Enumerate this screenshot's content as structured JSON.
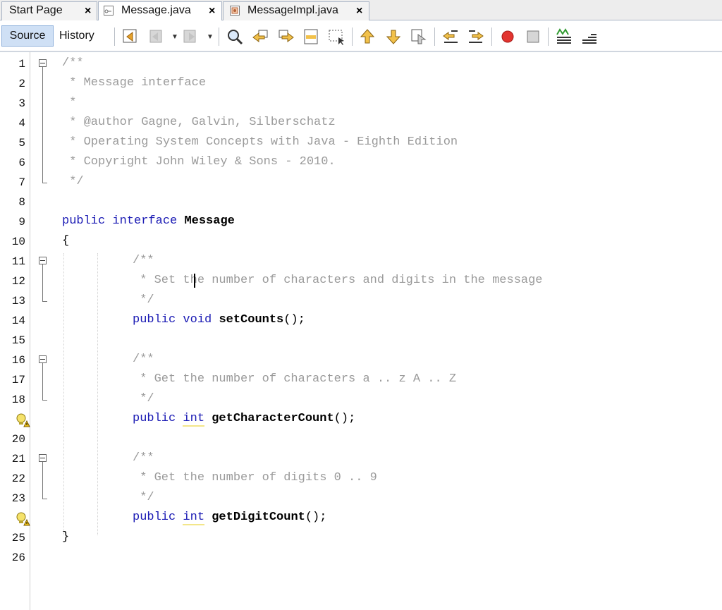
{
  "tabs": [
    {
      "label": "Start Page",
      "icon": "none",
      "active": false
    },
    {
      "label": "Message.java",
      "icon": "java-interface-icon",
      "active": true
    },
    {
      "label": "MessageImpl.java",
      "icon": "java-class-icon",
      "active": false
    }
  ],
  "toolbar": {
    "source_label": "Source",
    "history_label": "History",
    "icons": [
      "last-edit-icon",
      "back-icon",
      "forward-icon",
      "find-selection-icon",
      "find-previous-icon",
      "find-next-icon",
      "toggle-highlight-icon",
      "toggle-rectangular-selection-icon",
      "previous-bookmark-icon",
      "next-bookmark-icon",
      "toggle-bookmark-icon",
      "shift-left-icon",
      "shift-right-icon",
      "start-macro-icon",
      "stop-macro-icon",
      "comment-icon",
      "uncomment-icon"
    ]
  },
  "gutter": {
    "line_numbers": [
      "1",
      "2",
      "3",
      "4",
      "5",
      "6",
      "7",
      "8",
      "9",
      "10",
      "11",
      "12",
      "13",
      "14",
      "15",
      "16",
      "17",
      "18",
      "",
      "20",
      "21",
      "22",
      "23",
      "",
      "25",
      "26"
    ],
    "hint_lines": [
      19,
      24
    ]
  },
  "code_lines": [
    "/**",
    " * Message interface",
    " *",
    " * @author Gagne, Galvin, Silberschatz",
    " * Operating System Concepts with Java - Eighth Edition",
    " * Copyright John Wiley & Sons - 2010.",
    " */",
    "",
    "public interface Message",
    "{",
    "/**",
    " * Set the number of characters and digits in the message",
    " */",
    "public void setCounts();",
    "",
    "/**",
    " * Get the number of characters a .. z A .. Z",
    " */",
    "public int getCharacterCount();",
    "",
    "/**",
    " * Get the number of digits 0 .. 9",
    " */",
    "public int getDigitCount();",
    "}",
    ""
  ],
  "colors": {
    "keyword": "#1a1ab4",
    "comment": "#9a9a9a",
    "selected_tab": "#cfe0f5",
    "warning_underline": "#f3e68a"
  }
}
